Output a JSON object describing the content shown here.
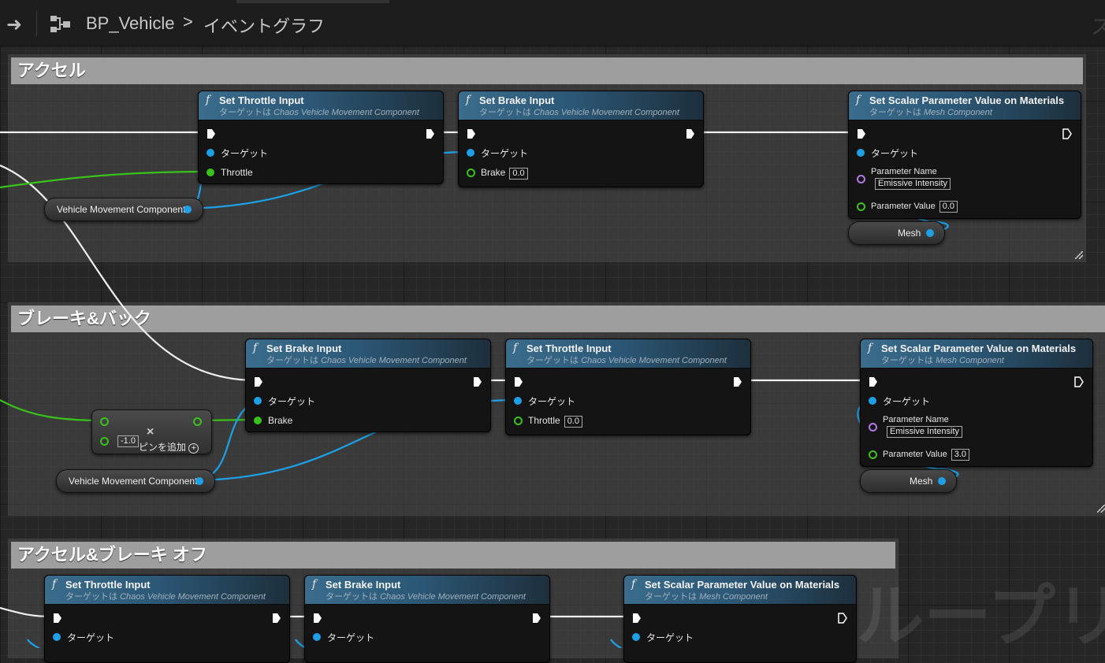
{
  "topbar": {
    "breadcrumb_blueprint": "BP_Vehicle",
    "breadcrumb_separator": ">",
    "breadcrumb_graph": "イベントグラフ",
    "corner_glyph": "ス"
  },
  "comments": [
    {
      "title": "アクセル"
    },
    {
      "title": "ブレーキ&バック"
    },
    {
      "title": "アクセル&ブレーキ オフ"
    }
  ],
  "labels": {
    "target": "ターゲット",
    "target_is_prefix": "ターゲットは",
    "chaos_component": "Chaos Vehicle Movement Component",
    "mesh_component": "Mesh Component",
    "set_throttle": "Set Throttle Input",
    "set_brake": "Set Brake Input",
    "set_scalar": "Set Scalar Parameter Value on Materials",
    "throttle": "Throttle",
    "brake": "Brake",
    "parameter_name": "Parameter Name",
    "parameter_value": "Parameter Value",
    "vehicle_movement_component": "Vehicle Movement Component",
    "mesh": "Mesh",
    "add_pin": "ピンを追加"
  },
  "values": {
    "g1_brake": "0.0",
    "g1_param_name": "Emissive Intensity",
    "g1_param_value": "0.0",
    "g2_throttle": "0.0",
    "g2_param_name": "Emissive Intensity",
    "g2_param_value": "3.0",
    "multiply_input": "-1.0"
  },
  "watermark": "ブループリン",
  "colors": {
    "exec_wire": "#f0f0f0",
    "object_wire": "#1ea0e6",
    "float_wire": "#39c21a",
    "node_header_blue": "#2c5877",
    "comment_header": "#9e9e9e"
  }
}
